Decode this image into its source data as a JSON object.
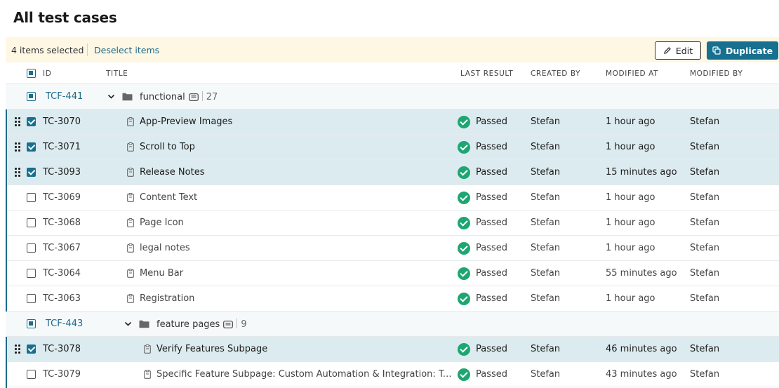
{
  "page_title": "All test cases",
  "selection": {
    "count_label": "4 items selected",
    "deselect_label": "Deselect items",
    "edit_label": "Edit",
    "duplicate_label": "Duplicate"
  },
  "columns": {
    "id": "ID",
    "title": "TITLE",
    "last_result": "LAST RESULT",
    "created_by": "CREATED BY",
    "modified_at": "MODIFIED AT",
    "modified_by": "MODIFIED BY"
  },
  "groups": [
    {
      "id": "TCF-441",
      "name": "functional",
      "count": "27"
    },
    {
      "id": "TCF-443",
      "name": "feature pages",
      "count": "9"
    }
  ],
  "rows": [
    {
      "id": "TC-3070",
      "title": "App-Preview Images",
      "result": "Passed",
      "created_by": "Stefan",
      "modified_at": "1 hour ago",
      "modified_by": "Stefan",
      "checked": true
    },
    {
      "id": "TC-3071",
      "title": "Scroll to Top",
      "result": "Passed",
      "created_by": "Stefan",
      "modified_at": "1 hour ago",
      "modified_by": "Stefan",
      "checked": true
    },
    {
      "id": "TC-3093",
      "title": "Release Notes",
      "result": "Passed",
      "created_by": "Stefan",
      "modified_at": "15 minutes ago",
      "modified_by": "Stefan",
      "checked": true
    },
    {
      "id": "TC-3069",
      "title": "Content Text",
      "result": "Passed",
      "created_by": "Stefan",
      "modified_at": "1 hour ago",
      "modified_by": "Stefan",
      "checked": false
    },
    {
      "id": "TC-3068",
      "title": "Page Icon",
      "result": "Passed",
      "created_by": "Stefan",
      "modified_at": "1 hour ago",
      "modified_by": "Stefan",
      "checked": false
    },
    {
      "id": "TC-3067",
      "title": "legal notes",
      "result": "Passed",
      "created_by": "Stefan",
      "modified_at": "1 hour ago",
      "modified_by": "Stefan",
      "checked": false
    },
    {
      "id": "TC-3064",
      "title": "Menu Bar",
      "result": "Passed",
      "created_by": "Stefan",
      "modified_at": "55 minutes ago",
      "modified_by": "Stefan",
      "checked": false
    },
    {
      "id": "TC-3063",
      "title": "Registration",
      "result": "Passed",
      "created_by": "Stefan",
      "modified_at": "1 hour ago",
      "modified_by": "Stefan",
      "checked": false
    },
    {
      "id": "TC-3078",
      "title": "Verify Features Subpage",
      "result": "Passed",
      "created_by": "Stefan",
      "modified_at": "46 minutes ago",
      "modified_by": "Stefan",
      "checked": true
    },
    {
      "id": "TC-3079",
      "title": "Specific Feature Subpage: Custom Automation & Integration: Testing",
      "result": "Passed",
      "created_by": "Stefan",
      "modified_at": "43 minutes ago",
      "modified_by": "Stefan",
      "checked": false
    }
  ],
  "colors": {
    "accent": "#17708f",
    "selected_row": "#dcebef",
    "selection_bar": "#fdf7e4",
    "passed": "#1ea672"
  }
}
